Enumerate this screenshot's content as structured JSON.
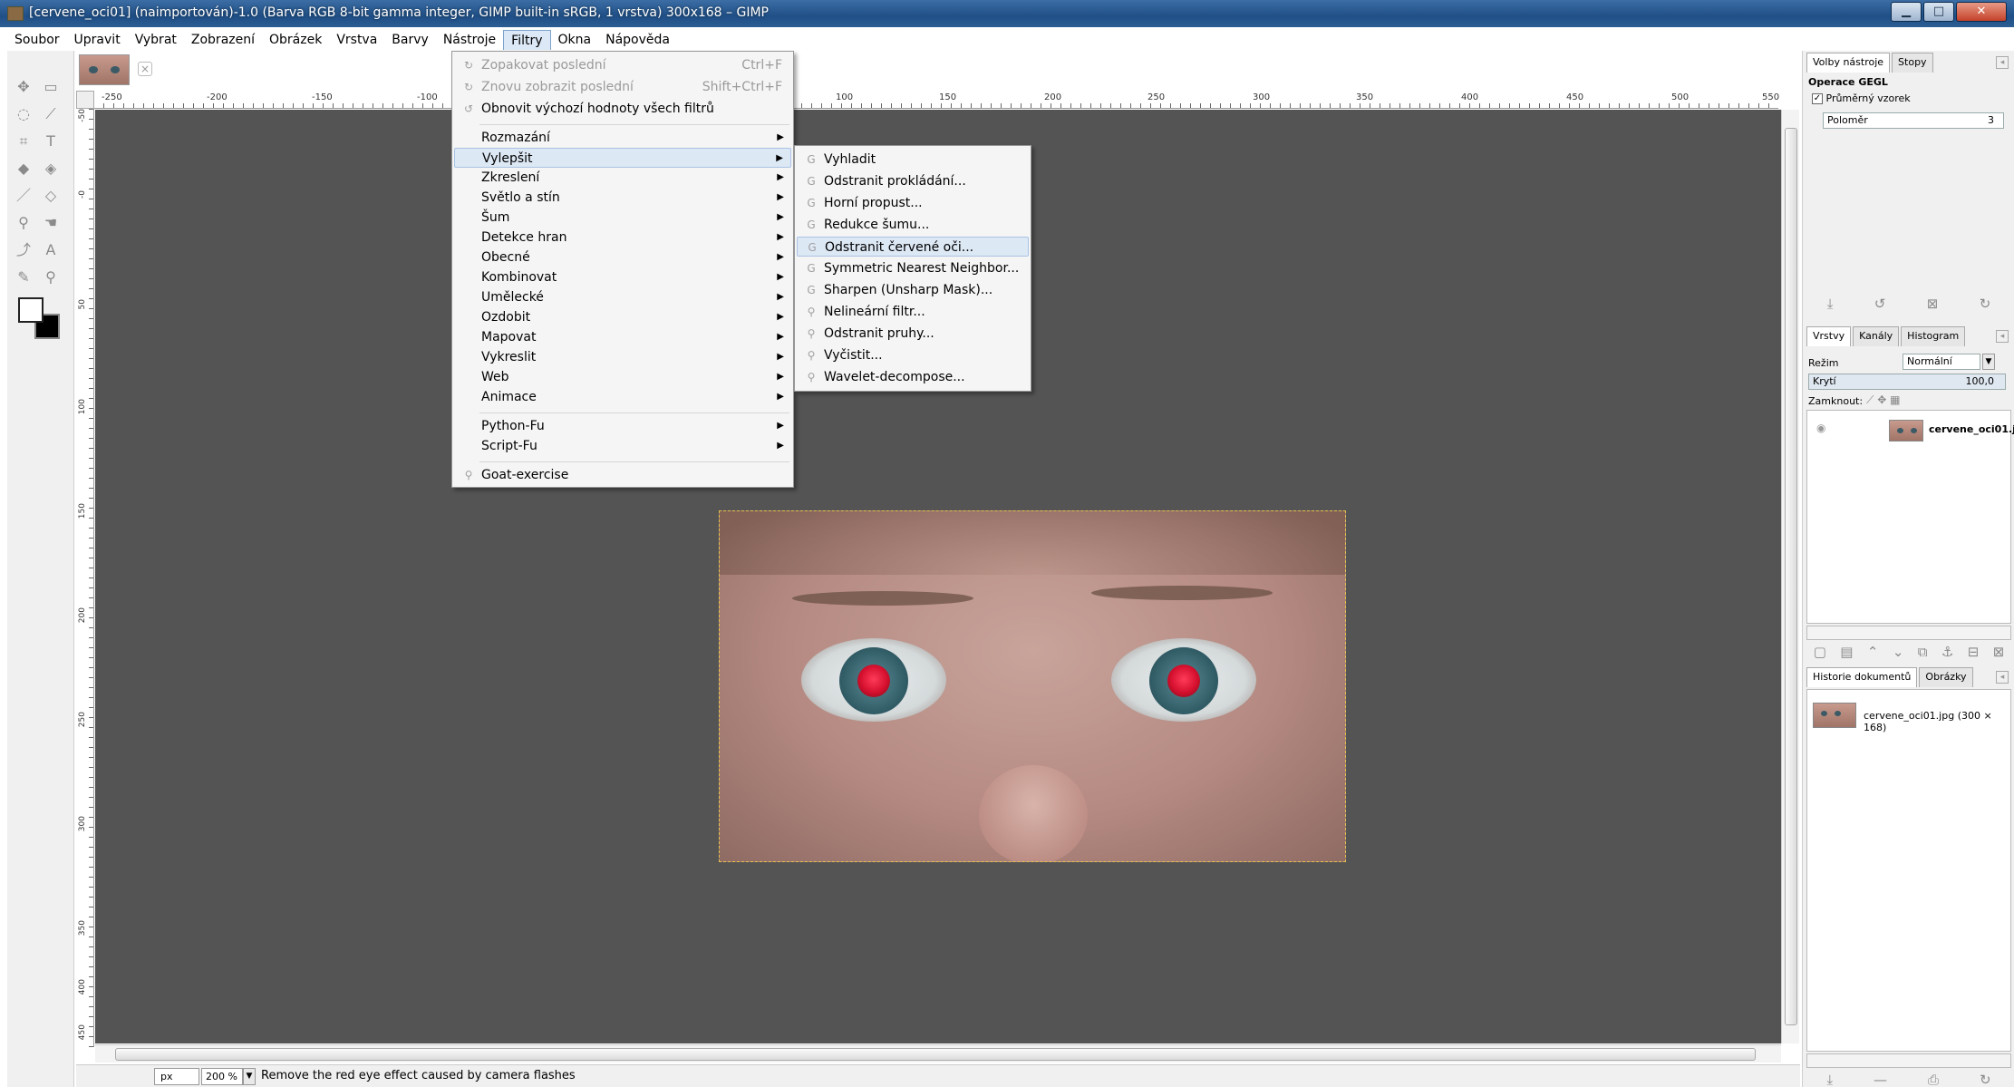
{
  "window": {
    "title": "[cervene_oci01] (naimportován)-1.0 (Barva RGB 8-bit gamma integer, GIMP built-in sRGB, 1 vrstva) 300x168 – GIMP",
    "minimize": "▁",
    "maximize": "□",
    "close": "✕"
  },
  "menubar": [
    {
      "label": "Soubor"
    },
    {
      "label": "Upravit"
    },
    {
      "label": "Vybrat"
    },
    {
      "label": "Zobrazení"
    },
    {
      "label": "Obrázek"
    },
    {
      "label": "Vrstva"
    },
    {
      "label": "Barvy"
    },
    {
      "label": "Nástroje"
    },
    {
      "label": "Filtry"
    },
    {
      "label": "Okna"
    },
    {
      "label": "Nápověda"
    }
  ],
  "ruler": {
    "h_labels": [
      "-250",
      "-200",
      "-150",
      "-100",
      "100",
      "150",
      "200",
      "250",
      "300",
      "350",
      "400",
      "450",
      "500",
      "550"
    ],
    "v_labels": [
      "-50",
      "-0",
      "50",
      "100",
      "150",
      "200",
      "250",
      "300",
      "350",
      "400",
      "450"
    ]
  },
  "filters_menu": {
    "repeat_last": "Zopakovat poslední",
    "repeat_last_shortcut": "Ctrl+F",
    "reshow_last": "Znovu zobrazit poslední",
    "reshow_last_shortcut": "Shift+Ctrl+F",
    "reset_all": "Obnovit výchozí hodnoty všech filtrů",
    "items": [
      "Rozmazání",
      "Vylepšit",
      "Zkreslení",
      "Světlo a stín",
      "Šum",
      "Detekce hran",
      "Obecné",
      "Kombinovat",
      "Umělecké",
      "Ozdobit",
      "Mapovat",
      "Vykreslit",
      "Web",
      "Animace"
    ],
    "scripts": [
      "Python-Fu",
      "Script-Fu"
    ],
    "goat": "Goat-exercise"
  },
  "enhance_submenu": {
    "items": [
      "Vyhladit",
      "Odstranit prokládání...",
      "Horní propust...",
      "Redukce šumu...",
      "Odstranit červené oči...",
      "Symmetric Nearest Neighbor...",
      "Sharpen (Unsharp Mask)...",
      "Nelineární filtr...",
      "Odstranit pruhy...",
      "Vyčistit...",
      "Wavelet-decompose..."
    ],
    "highlighted": "Odstranit červené oči..."
  },
  "statusbar": {
    "unit": "px",
    "zoom": "200 %",
    "message": "Remove the red eye effect caused by camera flashes"
  },
  "dock": {
    "tool_options_tab": "Volby nástroje",
    "paths_tab": "Stopy",
    "gegl_title": "Operace GEGL",
    "sample_average": "Průměrný vzorek",
    "radius_label": "Poloměr",
    "radius_value": "3",
    "layers_tab": "Vrstvy",
    "channels_tab": "Kanály",
    "histogram_tab": "Histogram",
    "mode_label": "Režim",
    "mode_value": "Normální",
    "opacity_label": "Krytí",
    "opacity_value": "100,0",
    "lock_label": "Zamknout:",
    "layer_name": "cervene_oci01.jp",
    "history_tab": "Historie dokumentů",
    "images_tab": "Obrázky",
    "image_entry": "cervene_oci01.jpg (300 × 168)"
  }
}
